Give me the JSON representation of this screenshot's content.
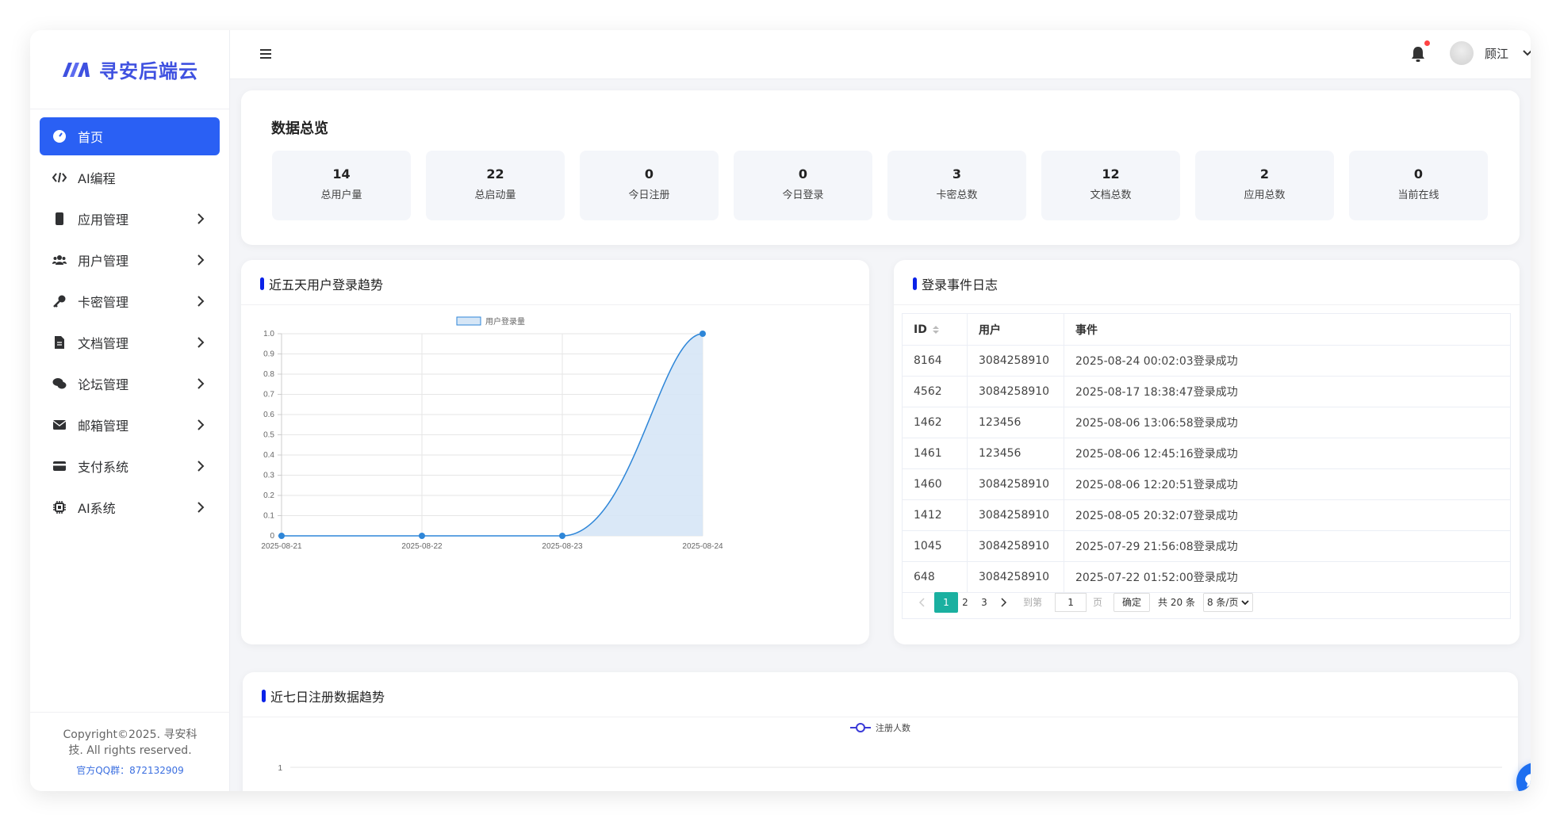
{
  "app": {
    "brand": "寻安后端云",
    "colors": {
      "primary": "#2a60f4",
      "brand": "#3f51e0",
      "accent_bar": "#0b22e8",
      "pager_active": "#1ab0a0",
      "line": "#2e86d8",
      "area": "#d6e6f6"
    }
  },
  "sidebar": {
    "items": [
      {
        "label": "首页",
        "icon": "dashboard-icon",
        "active": true,
        "has_children": false
      },
      {
        "label": "AI编程",
        "icon": "code-icon",
        "active": false,
        "has_children": false
      },
      {
        "label": "应用管理",
        "icon": "mobile-icon",
        "active": false,
        "has_children": true
      },
      {
        "label": "用户管理",
        "icon": "users-icon",
        "active": false,
        "has_children": true
      },
      {
        "label": "卡密管理",
        "icon": "key-icon",
        "active": false,
        "has_children": true
      },
      {
        "label": "文档管理",
        "icon": "file-icon",
        "active": false,
        "has_children": true
      },
      {
        "label": "论坛管理",
        "icon": "comments-icon",
        "active": false,
        "has_children": true
      },
      {
        "label": "邮箱管理",
        "icon": "envelope-icon",
        "active": false,
        "has_children": true
      },
      {
        "label": "支付系统",
        "icon": "credit-card-icon",
        "active": false,
        "has_children": true
      },
      {
        "label": "AI系统",
        "icon": "chip-icon",
        "active": false,
        "has_children": true
      }
    ],
    "footer": {
      "copyright": "Copyright©2025. 寻安科技. All rights reserved.",
      "qq": "官方QQ群：872132909"
    }
  },
  "header": {
    "user_name": "顾江",
    "has_notification": true
  },
  "overview": {
    "title": "数据总览",
    "stats": [
      {
        "value": "14",
        "label": "总用户量"
      },
      {
        "value": "22",
        "label": "总启动量"
      },
      {
        "value": "0",
        "label": "今日注册"
      },
      {
        "value": "0",
        "label": "今日登录"
      },
      {
        "value": "3",
        "label": "卡密总数"
      },
      {
        "value": "12",
        "label": "文档总数"
      },
      {
        "value": "2",
        "label": "应用总数"
      },
      {
        "value": "0",
        "label": "当前在线"
      }
    ]
  },
  "login_trend": {
    "title": "近五天用户登录趋势"
  },
  "log": {
    "title": "登录事件日志",
    "columns": [
      "ID",
      "用户",
      "事件"
    ],
    "rows": [
      [
        "8164",
        "3084258910",
        "2025-08-24 00:02:03登录成功"
      ],
      [
        "4562",
        "3084258910",
        "2025-08-17 18:38:47登录成功"
      ],
      [
        "1462",
        "123456",
        "2025-08-06 13:06:58登录成功"
      ],
      [
        "1461",
        "123456",
        "2025-08-06 12:45:16登录成功"
      ],
      [
        "1460",
        "3084258910",
        "2025-08-06 12:20:51登录成功"
      ],
      [
        "1412",
        "3084258910",
        "2025-08-05 20:32:07登录成功"
      ],
      [
        "1045",
        "3084258910",
        "2025-07-29 21:56:08登录成功"
      ],
      [
        "648",
        "3084258910",
        "2025-07-22 01:52:00登录成功"
      ]
    ],
    "pager": {
      "pages": [
        "1",
        "2",
        "3"
      ],
      "current_page": "1",
      "goto_prefix": "到第",
      "goto_value": "1",
      "goto_suffix": "页",
      "confirm": "确定",
      "total": "共 20 条",
      "page_size": "8 条/页"
    }
  },
  "reg_trend": {
    "title": "近七日注册数据趋势"
  },
  "chart_data": [
    {
      "type": "area",
      "legend": [
        "用户登录量"
      ],
      "legend_position": "top-center",
      "x": [
        "2025-08-21",
        "2025-08-22",
        "2025-08-23",
        "2025-08-24"
      ],
      "series": [
        {
          "name": "用户登录量",
          "values": [
            0,
            0,
            0,
            1
          ]
        }
      ],
      "ylim": [
        0,
        1.0
      ],
      "yticks": [
        "0",
        "0.1",
        "0.2",
        "0.3",
        "0.4",
        "0.5",
        "0.6",
        "0.7",
        "0.8",
        "0.9",
        "1.0"
      ],
      "grid": true,
      "smooth": true
    },
    {
      "type": "line",
      "legend": [
        "注册人数"
      ],
      "legend_position": "top-center",
      "series": [
        {
          "name": "注册人数",
          "values": []
        }
      ],
      "yticks": [
        "1"
      ],
      "grid": true
    }
  ]
}
